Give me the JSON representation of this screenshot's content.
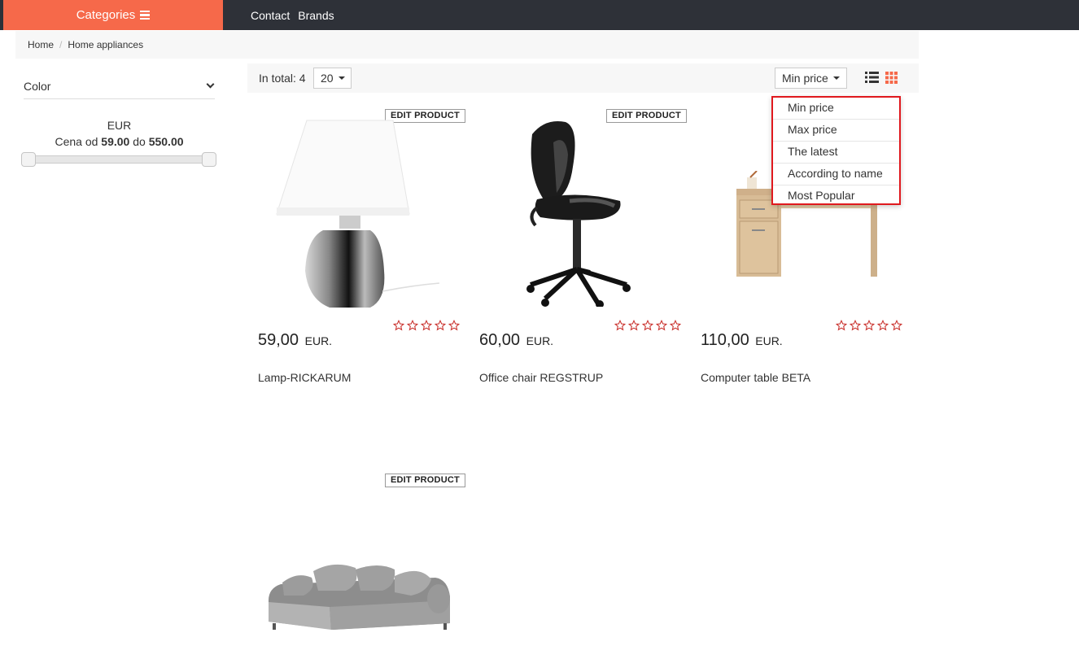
{
  "topbar": {
    "categories_label": "Categories",
    "nav": [
      "Contact",
      "Brands"
    ]
  },
  "breadcrumb": [
    "Home",
    "Home appliances"
  ],
  "sidebar": {
    "color_filter_label": "Color",
    "currency": "EUR",
    "price_prefix": "Cena od",
    "price_min": "59.00",
    "price_mid": "do",
    "price_max": "550.00"
  },
  "toolbar": {
    "total_label": "In total: 4",
    "per_page": "20",
    "sort_selected": "Min price"
  },
  "sort_options": [
    "Min price",
    "Max price",
    "The latest",
    "According to name",
    "Most Popular"
  ],
  "edit_label": "EDIT PRODUCT",
  "products": [
    {
      "price": "59,00",
      "currency": "EUR.",
      "name": "Lamp-RICKARUM",
      "rating": 0
    },
    {
      "price": "60,00",
      "currency": "EUR.",
      "name": "Office chair REGSTRUP",
      "rating": 0
    },
    {
      "price": "110,00",
      "currency": "EUR.",
      "name": "Computer table BETA",
      "rating": 0
    },
    {
      "price": "",
      "currency": "",
      "name": "",
      "rating": 0
    }
  ],
  "colors": {
    "accent": "#f6694a",
    "topbar": "#2e3138",
    "dropdown_border": "#e0191e",
    "star": "#c9302c"
  }
}
